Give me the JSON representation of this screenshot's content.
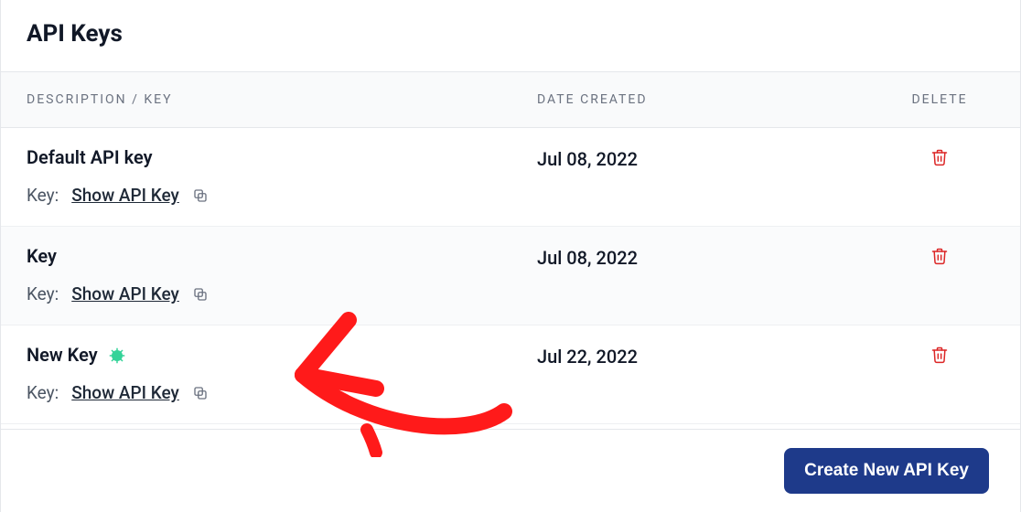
{
  "header": {
    "title": "API Keys"
  },
  "columns": {
    "description": "DESCRIPTION / KEY",
    "date": "DATE CREATED",
    "delete": "DELETE"
  },
  "labels": {
    "key_prefix": "Key:",
    "show_key": "Show API Key"
  },
  "rows": [
    {
      "title": "Default API key",
      "date": "Jul 08, 2022",
      "is_new": false
    },
    {
      "title": "Key",
      "date": "Jul 08, 2022",
      "is_new": false
    },
    {
      "title": "New Key",
      "date": "Jul 22, 2022",
      "is_new": true
    }
  ],
  "footer": {
    "create_label": "Create New API Key"
  }
}
